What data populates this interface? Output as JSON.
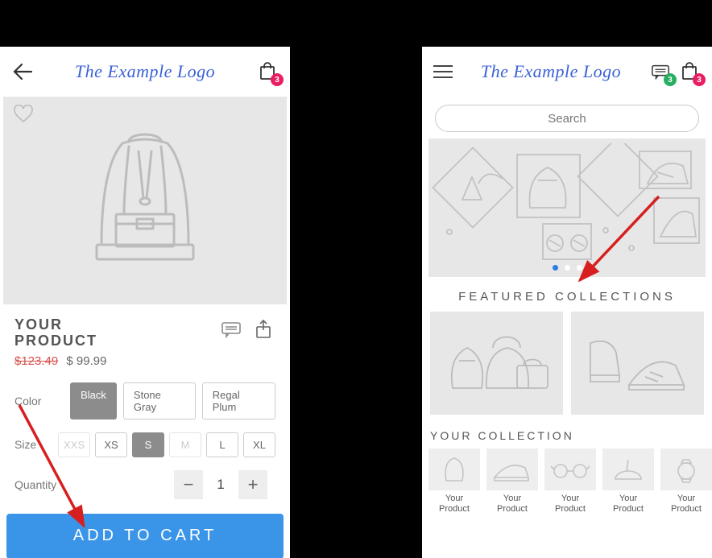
{
  "brand": "The Example Logo",
  "cart_badge": "3",
  "chat_badge": "3",
  "product": {
    "title_l1": "YOUR",
    "title_l2": "PRODUCT",
    "price_old": "$123.49",
    "price_new": "$ 99.99",
    "color_label": "Color",
    "colors": [
      "Black",
      "Stone Gray",
      "Regal Plum"
    ],
    "color_selected_index": 0,
    "size_label": "Size",
    "sizes": [
      "XXS",
      "XS",
      "S",
      "M",
      "L",
      "XL"
    ],
    "size_selected_index": 2,
    "size_disabled": [
      0,
      3
    ],
    "qty_label": "Quantity",
    "qty": "1",
    "add_label": "ADD TO CART"
  },
  "store": {
    "search_placeholder": "Search",
    "featured_title": "FEATURED COLLECTIONS",
    "collection_title": "YOUR COLLECTION",
    "product_label": "Your Product"
  }
}
